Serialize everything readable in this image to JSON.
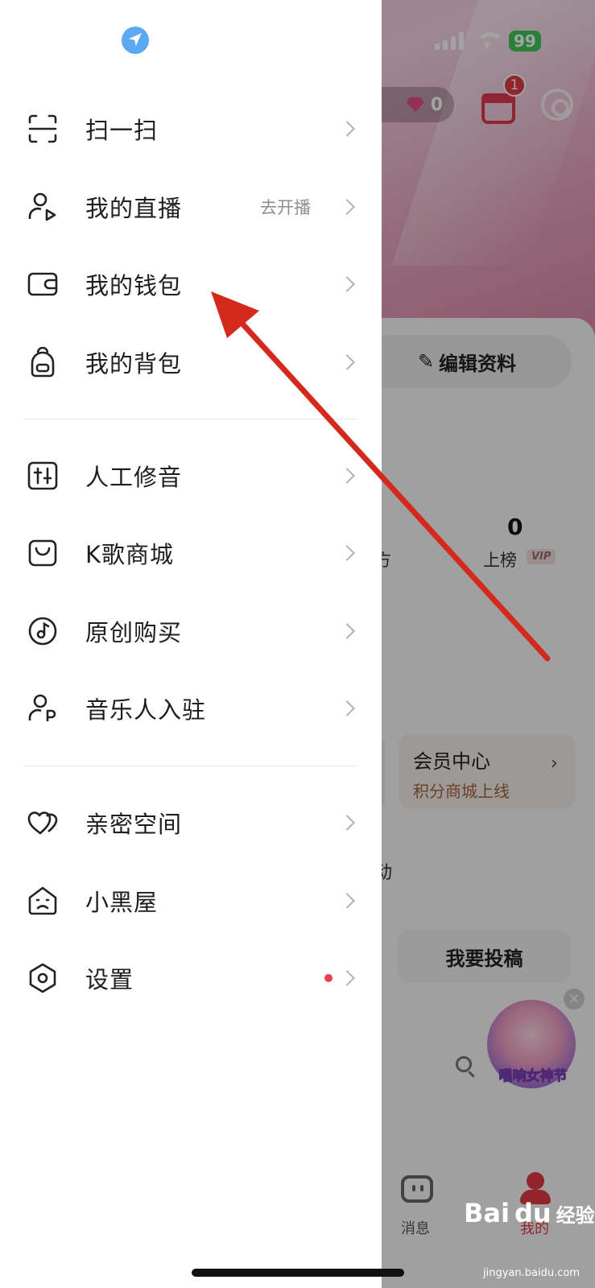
{
  "status_bar": {
    "battery": "99"
  },
  "background_app": {
    "gem_count": "0",
    "calendar_badge": "1",
    "edit_profile_label": "编辑资料",
    "stats": {
      "value": "0",
      "label": "上榜",
      "vip_tag": "VIP",
      "partial_left_label": "方"
    },
    "member_center": {
      "title": "会员中心",
      "subtitle": "积分商城上线"
    },
    "partial_section_char": "动",
    "submit_button": "我要投稿",
    "promo_text": "唱响女神节",
    "tabs": {
      "messages": "消息",
      "me": "我的"
    }
  },
  "drawer": {
    "items_group1": [
      {
        "label": "扫一扫",
        "icon": "scan-icon"
      },
      {
        "label": "我的直播",
        "icon": "live-user-icon",
        "hint": "去开播"
      },
      {
        "label": "我的钱包",
        "icon": "wallet-icon"
      },
      {
        "label": "我的背包",
        "icon": "backpack-icon"
      }
    ],
    "items_group2": [
      {
        "label": "人工修音",
        "icon": "equalizer-icon"
      },
      {
        "label": "K歌商城",
        "icon": "shopping-bag-icon"
      },
      {
        "label": "原创购买",
        "icon": "music-disc-icon"
      },
      {
        "label": "音乐人入驻",
        "icon": "musician-icon"
      }
    ],
    "items_group3": [
      {
        "label": "亲密空间",
        "icon": "hearts-icon"
      },
      {
        "label": "小黑屋",
        "icon": "house-face-icon"
      },
      {
        "label": "设置",
        "icon": "settings-hexagon-icon",
        "badge": "red-dot"
      }
    ]
  },
  "annotation": {
    "color": "#d42a1e",
    "points_to": "我的钱包"
  },
  "watermark": {
    "brand": "Bai",
    "brand2": "du",
    "suffix": "经验",
    "url": "jingyan.baidu.com"
  },
  "colors": {
    "accent": "#e23a46",
    "drawer_bg": "#ffffff",
    "hint_gray": "#8e8e8e"
  }
}
